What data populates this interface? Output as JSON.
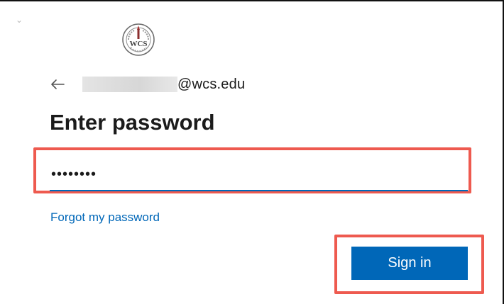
{
  "login": {
    "logo_icon": "school-seal-icon",
    "back_icon": "arrow-left-icon",
    "email_domain": "@wcs.edu",
    "title": "Enter password",
    "password_value": "••••••••",
    "forgot_link": "Forgot my password",
    "sign_in_label": "Sign in"
  },
  "colors": {
    "accent": "#0067b8",
    "highlight_box": "#ee5a4f",
    "title_text": "#1b1b1b"
  }
}
